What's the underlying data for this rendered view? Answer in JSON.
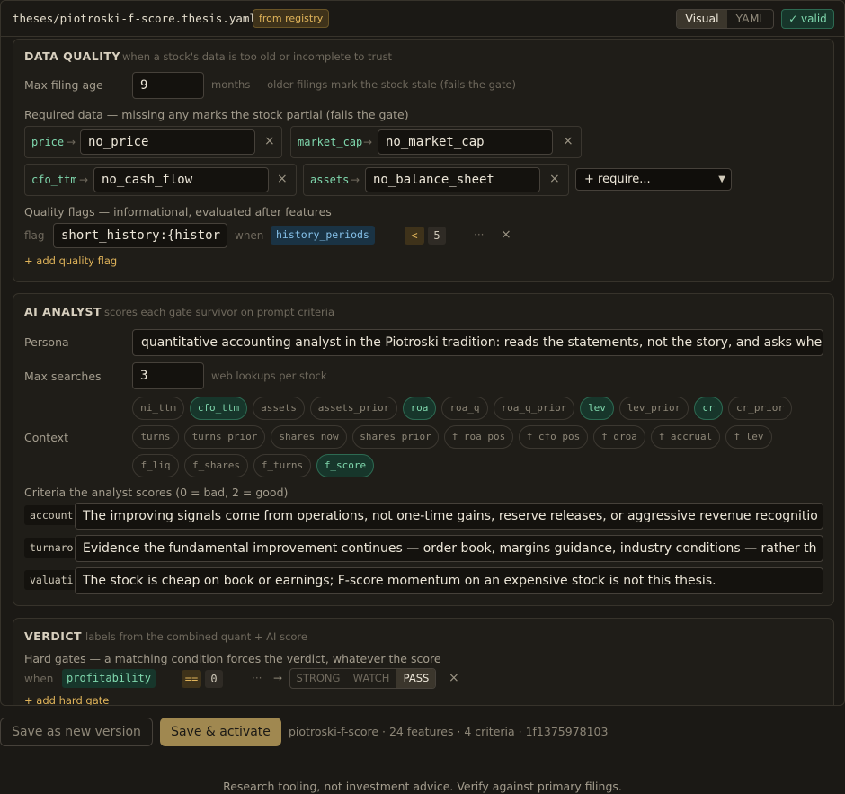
{
  "header": {
    "path": "theses/piotroski-f-score.thesis.yaml",
    "badge": "from registry",
    "view_visual": "Visual",
    "view_yaml": "YAML",
    "valid": "✓ valid"
  },
  "data_quality": {
    "title": "DATA QUALITY",
    "hint": "when a stock's data is too old or incomplete to trust",
    "max_filing_label": "Max filing age",
    "max_filing_value": "9",
    "max_filing_hint": "months — older filings mark the stock stale (fails the gate)",
    "required_label": "Required data — missing any marks the stock partial (fails the gate)",
    "required": [
      {
        "field": "price",
        "value": "no_price"
      },
      {
        "field": "market_cap",
        "value": "no_market_cap"
      },
      {
        "field": "cfo_ttm",
        "value": "no_cash_flow"
      },
      {
        "field": "assets",
        "value": "no_balance_sheet"
      }
    ],
    "arrow": "→",
    "remove": "×",
    "require_select": "+ require...",
    "flags_label": "Quality flags — informational, evaluated after features",
    "flag_word": "flag",
    "flag_value": "short_history:{histor",
    "when_word": "when",
    "flag_field": "history_periods",
    "flag_op": "<",
    "flag_num": "5",
    "more": "···",
    "add_flag": "+ add quality flag"
  },
  "ai_analyst": {
    "title": "AI ANALYST",
    "hint": "scores each gate survivor on prompt criteria",
    "persona_label": "Persona",
    "persona_value": "quantitative accounting analyst in the Piotroski tradition: reads the statements, not the story, and asks whe",
    "max_searches_label": "Max searches",
    "max_searches_value": "3",
    "max_searches_hint": "web lookups per stock",
    "context_label": "Context",
    "context": [
      {
        "name": "ni_ttm",
        "on": false
      },
      {
        "name": "cfo_ttm",
        "on": true
      },
      {
        "name": "assets",
        "on": false
      },
      {
        "name": "assets_prior",
        "on": false
      },
      {
        "name": "roa",
        "on": true
      },
      {
        "name": "roa_q",
        "on": false
      },
      {
        "name": "roa_q_prior",
        "on": false
      },
      {
        "name": "lev",
        "on": true
      },
      {
        "name": "lev_prior",
        "on": false
      },
      {
        "name": "cr",
        "on": true
      },
      {
        "name": "cr_prior",
        "on": false
      },
      {
        "name": "turns",
        "on": false
      },
      {
        "name": "turns_prior",
        "on": false
      },
      {
        "name": "shares_now",
        "on": false
      },
      {
        "name": "shares_prior",
        "on": false
      },
      {
        "name": "f_roa_pos",
        "on": false
      },
      {
        "name": "f_cfo_pos",
        "on": false
      },
      {
        "name": "f_droa",
        "on": false
      },
      {
        "name": "f_accrual",
        "on": false
      },
      {
        "name": "f_lev",
        "on": false
      },
      {
        "name": "f_liq",
        "on": false
      },
      {
        "name": "f_shares",
        "on": false
      },
      {
        "name": "f_turns",
        "on": false
      },
      {
        "name": "f_score",
        "on": true
      }
    ],
    "criteria_label": "Criteria the analyst scores (0 = bad, 2 = good)",
    "criteria": [
      {
        "key": "account",
        "text": "The improving signals come from operations, not one-time gains, reserve releases, or aggressive revenue recognitio"
      },
      {
        "key": "turnaro",
        "text": "Evidence the fundamental improvement continues — order book, margins guidance, industry conditions — rather th"
      },
      {
        "key": "valuati",
        "text": "The stock is cheap on book or earnings; F-score momentum on an expensive stock is not this thesis."
      }
    ]
  },
  "verdict": {
    "title": "VERDICT",
    "hint": "labels from the combined quant + AI score",
    "gates_label": "Hard gates — a matching condition forces the verdict, whatever the score",
    "when_word": "when",
    "field": "profitability",
    "op": "==",
    "value": "0",
    "more": "···",
    "arrow": "→",
    "options": [
      "STRONG",
      "WATCH",
      "PASS"
    ],
    "selected": "PASS",
    "remove": "×",
    "add_gate": "+ add hard gate"
  },
  "footer": {
    "save_new": "Save as new version",
    "save_activate": "Save & activate",
    "meta": "piotroski-f-score · 24 features · 4 criteria · 1f1375978103",
    "disclaimer": "Research tooling, not investment advice. Verify against primary filings."
  },
  "colors": {
    "accent": "#a08850",
    "valid": "#7fd7ad",
    "badge": "#e0b45a"
  }
}
